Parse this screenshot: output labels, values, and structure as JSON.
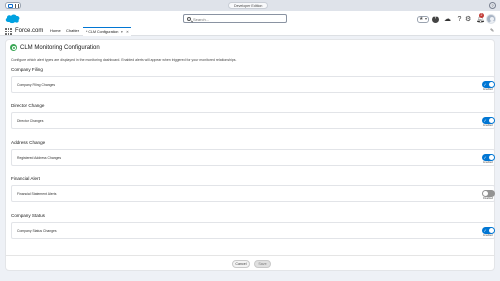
{
  "edition_bar": {
    "label": "Developer Edition"
  },
  "header": {
    "search_placeholder": "Search...",
    "notification_count": "2"
  },
  "nav": {
    "app_name": "Force.com",
    "items": [
      "Home",
      "Chatter"
    ],
    "active_tab": "* CLM Configuration"
  },
  "page": {
    "title": "CLM Monitoring Configuration",
    "description": "Configure which alert types are displayed in the monitoring dashboard. Enabled alerts will appear when triggered for your monitored relationships.",
    "sections": [
      {
        "title": "Company Filing",
        "row_label": "Company Filing Changes",
        "enabled": true,
        "state_label": "Enabled"
      },
      {
        "title": "Director Change",
        "row_label": "Director Changes",
        "enabled": true,
        "state_label": "Enabled"
      },
      {
        "title": "Address Change",
        "row_label": "Registered Address Changes",
        "enabled": true,
        "state_label": "Enabled"
      },
      {
        "title": "Financial Alert",
        "row_label": "Financial Statement Alerts",
        "enabled": false,
        "state_label": "Disabled"
      },
      {
        "title": "Company Status",
        "row_label": "Company Status Changes",
        "enabled": true,
        "state_label": "Enabled"
      }
    ]
  },
  "footer": {
    "cancel_label": "Cancel",
    "save_label": "Save"
  },
  "colors": {
    "brand_blue": "#0176d3",
    "toggle_off": "#939393",
    "title_icon": "#3ba755",
    "badge_red": "#c23934"
  },
  "icons": [
    "app-switcher-icon",
    "salesforce-cloud-icon",
    "search-icon",
    "favorites-star-icon",
    "global-add-icon",
    "trailhead-icon",
    "help-icon",
    "setup-gear-icon",
    "notification-bell-icon",
    "waffle-icon",
    "edit-pencil-icon"
  ]
}
